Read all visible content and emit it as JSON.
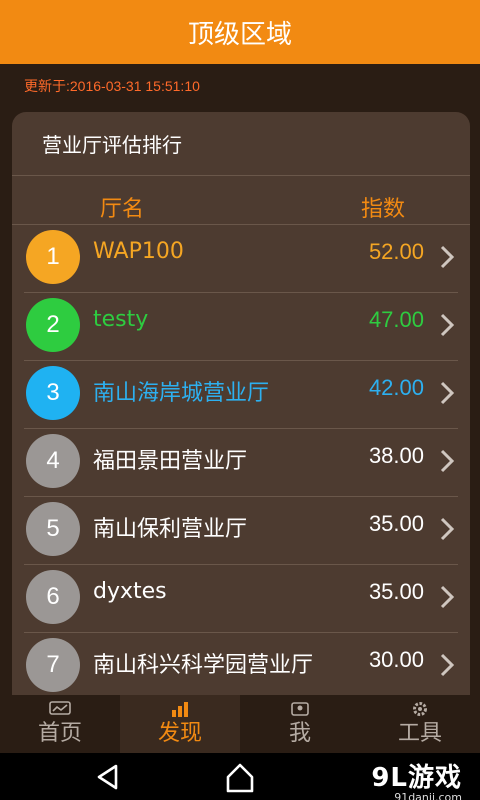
{
  "header": {
    "title": "顶级区域"
  },
  "update_time": "更新于:2016-03-31 15:51:10",
  "card": {
    "title": "营业厅评估排行",
    "col_name": "厅名",
    "col_index": "指数"
  },
  "rows": [
    {
      "rank": "1",
      "name": "WAP100",
      "score": "52.00",
      "color": "#f5a623",
      "badge": "#f5a623"
    },
    {
      "rank": "2",
      "name": "testy",
      "score": "47.00",
      "color": "#2ecc40",
      "badge": "#2ecc40"
    },
    {
      "rank": "3",
      "name": "南山海岸城营业厅",
      "score": "42.00",
      "color": "#2db0f0",
      "badge": "#1fb2f2"
    },
    {
      "rank": "4",
      "name": "福田景田营业厅",
      "score": "38.00",
      "color": "#ffffff",
      "badge": "#9b9795"
    },
    {
      "rank": "5",
      "name": "南山保利营业厅",
      "score": "35.00",
      "color": "#ffffff",
      "badge": "#9b9795"
    },
    {
      "rank": "6",
      "name": "dyxtes",
      "score": "35.00",
      "color": "#ffffff",
      "badge": "#9b9795"
    },
    {
      "rank": "7",
      "name": "南山科兴科学园营业厅",
      "score": "30.00",
      "color": "#ffffff",
      "badge": "#9b9795"
    }
  ],
  "tabs": [
    {
      "label": "首页",
      "icon": "chart-line-icon",
      "active": false
    },
    {
      "label": "发现",
      "icon": "bar-chart-icon",
      "active": true
    },
    {
      "label": "我",
      "icon": "profile-icon",
      "active": false
    },
    {
      "label": "工具",
      "icon": "gear-icon",
      "active": false
    }
  ],
  "watermark": {
    "main": "9L游戏",
    "sub": "91danji.com"
  },
  "colors": {
    "accent": "#f28a12",
    "background": "#2a1d14",
    "card": "#4d3b30"
  }
}
